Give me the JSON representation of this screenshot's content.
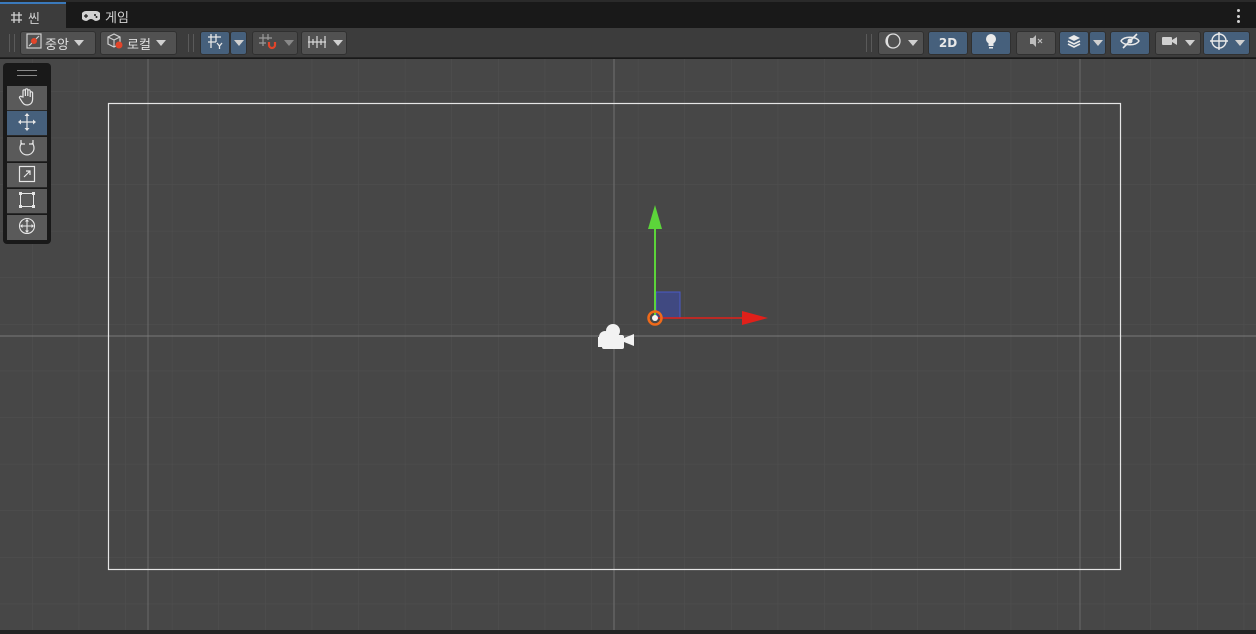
{
  "tabs": [
    {
      "label": "씬",
      "icon": "grid-hash-icon",
      "active": true
    },
    {
      "label": "게임",
      "icon": "gamepad-icon",
      "active": false
    }
  ],
  "toolbar": {
    "pivot_label": "중앙",
    "space_label": "로컬",
    "mode_2d_label": "2D"
  },
  "tools": [
    {
      "name": "hand-tool",
      "icon": "hand-icon",
      "selected": false
    },
    {
      "name": "move-tool",
      "icon": "move-arrows-icon",
      "selected": true
    },
    {
      "name": "rotate-tool",
      "icon": "rotate-icon",
      "selected": false
    },
    {
      "name": "scale-tool",
      "icon": "scale-icon",
      "selected": false
    },
    {
      "name": "rect-tool",
      "icon": "rect-transform-icon",
      "selected": false
    },
    {
      "name": "transform-tool",
      "icon": "transform-icon",
      "selected": false
    }
  ],
  "colors": {
    "accent_blue": "#46607c",
    "axis_x": "#e0201a",
    "axis_y": "#5cd43a",
    "axis_z_plane": "#3a4ab0",
    "pivot": "#f06a1a"
  }
}
